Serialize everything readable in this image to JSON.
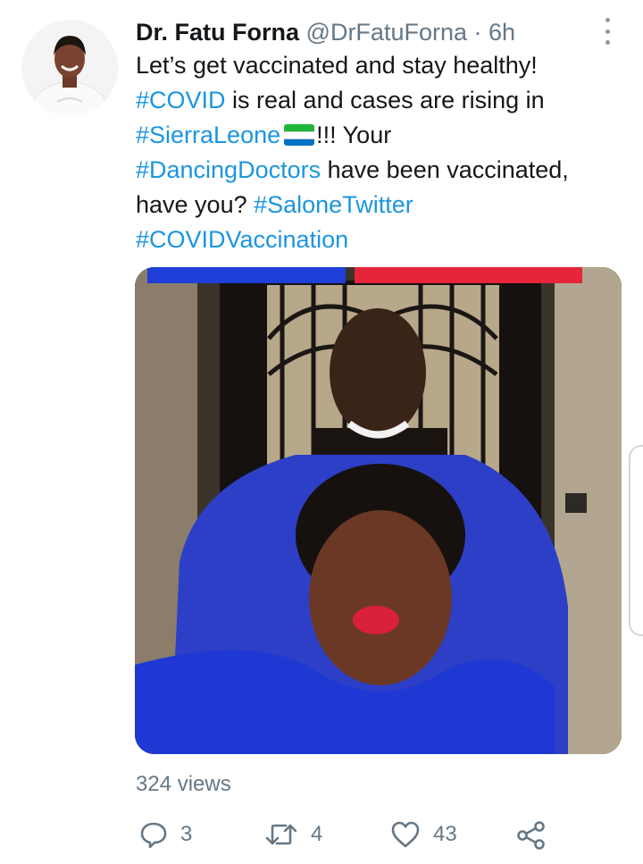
{
  "tweet": {
    "author_name": "Dr. Fatu Forna",
    "handle": "@DrFatuForna",
    "separator": "·",
    "time": "6h",
    "text_line1": "Let’s get vaccinated and stay healthy!",
    "tag_covid": "#COVID",
    "text_mid": " is real and cases are rising in",
    "tag_sierraleone": "#SierraLeone",
    "flag_colors": [
      "#1eb53a",
      "#ffffff",
      "#0072c6"
    ],
    "text_after_flag": "!!! Your",
    "tag_dancingdoctors": "#DancingDoctors",
    "text_after_dd": " have been vaccinated,",
    "text_have_you": "have you? ",
    "tag_salonetwitter": "#SaloneTwitter",
    "tag_covidvaccination": "#COVIDVaccination"
  },
  "media": {
    "views": "324 views"
  },
  "actions": {
    "reply_count": "3",
    "retweet_count": "4",
    "like_count": "43"
  },
  "colors": {
    "link": "#1b95e0",
    "secondary": "#657786"
  }
}
